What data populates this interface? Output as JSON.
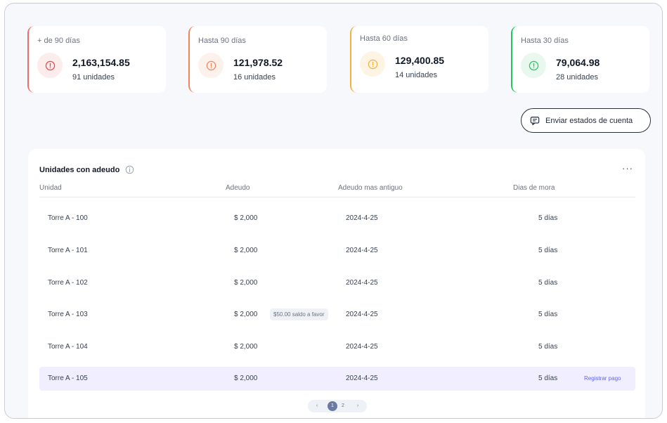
{
  "cards": [
    {
      "label": "+ de 90 días",
      "amount": "2,163,154.85",
      "units": "91 unidades",
      "color": "#ef6b6b",
      "bg": "#fdecec"
    },
    {
      "label": "Hasta 90 días",
      "amount": "121,978.52",
      "units": "16 unidades",
      "color": "#f2845c",
      "bg": "#fdf1ec"
    },
    {
      "label": "Hasta 60 días",
      "amount": "129,400.85",
      "units": "14 unidades",
      "color": "#f5b13d",
      "bg": "#fdf4e3"
    },
    {
      "label": "Hasta 30 días",
      "amount": "79,064.98",
      "units": "28 unidades",
      "color": "#22c55e",
      "bg": "#e9f8ee"
    }
  ],
  "send_button": {
    "label": "Enviar estados de cuenta",
    "icon": "message-icon"
  },
  "panel": {
    "title": "Unidades con adeudo",
    "info_icon": "info-icon",
    "more_icon": "···",
    "columns": [
      "Unidad",
      "Adeudo",
      "Adeudo mas antiguo",
      "Dias de mora"
    ],
    "rows": [
      {
        "unit": "Torre A - 100",
        "amount": "$ 2,000",
        "date": "2024-4-25",
        "days": "5 días",
        "badge": "",
        "action": ""
      },
      {
        "unit": "Torre A - 101",
        "amount": "$ 2,000",
        "date": "2024-4-25",
        "days": "5 días",
        "badge": "",
        "action": ""
      },
      {
        "unit": "Torre A - 102",
        "amount": "$ 2,000",
        "date": "2024-4-25",
        "days": "5 días",
        "badge": "",
        "action": ""
      },
      {
        "unit": "Torre A - 103",
        "amount": "$ 2,000",
        "date": "2024-4-25",
        "days": "5 días",
        "badge": "$50.00 saldo a favor",
        "action": ""
      },
      {
        "unit": "Torre A - 104",
        "amount": "$ 2,000",
        "date": "2024-4-25",
        "days": "5 días",
        "badge": "",
        "action": ""
      },
      {
        "unit": "Torre A - 105",
        "amount": "$ 2,000",
        "date": "2024-4-25",
        "days": "5 días",
        "badge": "",
        "action": "Registrar pago",
        "highlighted": true
      }
    ]
  },
  "pagination": {
    "prev": "‹",
    "pages": [
      "1",
      "2"
    ],
    "current": "1",
    "next": "›"
  }
}
